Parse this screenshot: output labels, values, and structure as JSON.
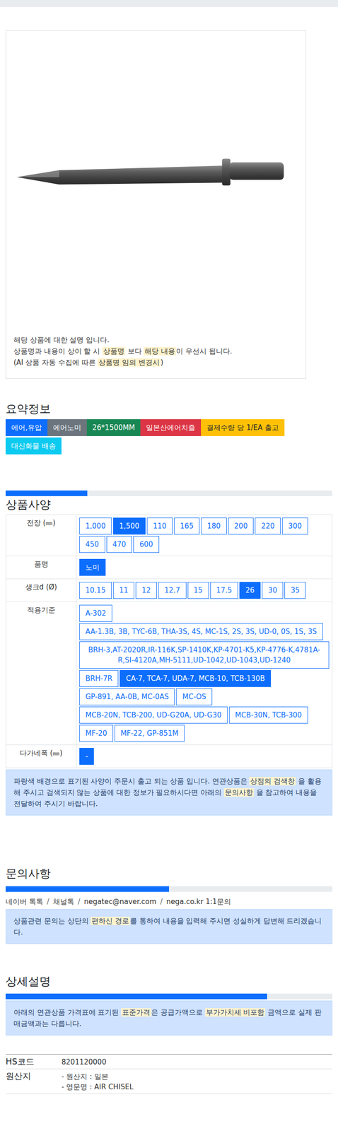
{
  "notice": {
    "lines": [
      [
        {
          "text": "해당 상품에 대한 설명 입니다.",
          "highlight": false
        }
      ],
      [
        {
          "text": "상품명과 내용이 상이 할 시 ",
          "highlight": false
        },
        {
          "text": "상품명",
          "highlight": true
        },
        {
          "text": " 보다 ",
          "highlight": false
        },
        {
          "text": "해당 내용",
          "highlight": true
        },
        {
          "text": "이 우선시 됩니다.",
          "highlight": false
        }
      ],
      [
        {
          "text": "(AI 상품 자동 수집에 따른 ",
          "highlight": false
        },
        {
          "text": "상품명 임의 변경시",
          "highlight": true
        },
        {
          "text": ")",
          "highlight": false
        }
      ]
    ]
  },
  "summary": {
    "title": "요약정보",
    "tags": [
      {
        "label": "에어,유압",
        "color": "#0d6efd"
      },
      {
        "label": "에어노미",
        "color": "#6c757d"
      },
      {
        "label": "26*1500MM",
        "color": "#198754"
      },
      {
        "label": "일본산에어치즐",
        "color": "#dc3545"
      },
      {
        "label": "결제수량 당 1/EA 출고",
        "color": "#ffc107"
      },
      {
        "label": "대신화물 배송",
        "color": "#0dcaf0"
      }
    ]
  },
  "specs": {
    "title": "상품사양",
    "level": 0.25,
    "rows": [
      {
        "label": "전장 (㎜)",
        "options": [
          {
            "label": "1,000",
            "selected": false
          },
          {
            "label": "1,500",
            "selected": true
          },
          {
            "label": "110",
            "selected": false
          },
          {
            "label": "165",
            "selected": false
          },
          {
            "label": "180",
            "selected": false
          },
          {
            "label": "200",
            "selected": false
          },
          {
            "label": "220",
            "selected": false
          },
          {
            "label": "300",
            "selected": false
          },
          {
            "label": "450",
            "selected": false
          },
          {
            "label": "470",
            "selected": false
          },
          {
            "label": "600",
            "selected": false
          }
        ]
      },
      {
        "label": "품명",
        "options": [
          {
            "label": "노미",
            "selected": true
          }
        ]
      },
      {
        "label": "생크d (Ø)",
        "options": [
          {
            "label": "10.15",
            "selected": false
          },
          {
            "label": "11",
            "selected": false
          },
          {
            "label": "12",
            "selected": false
          },
          {
            "label": "12.7",
            "selected": false
          },
          {
            "label": "15",
            "selected": false
          },
          {
            "label": "17.5",
            "selected": false
          },
          {
            "label": "26",
            "selected": true
          },
          {
            "label": "30",
            "selected": false
          },
          {
            "label": "35",
            "selected": false
          }
        ]
      },
      {
        "label": "적용기준",
        "options": [
          {
            "label": "A-302",
            "selected": false
          },
          {
            "label": "AA-1.3B, 3B, TYC-6B, THA-3S, 4S, MC-1S, 2S, 3S, UD-0, 0S, 1S, 3S",
            "selected": false
          },
          {
            "label": "BRH-3,AT-2020R,IR-116K,SP-1410K,KP-4701-K5,KP-4776-K,4781A-R,SI-4120A,MH-5111,UD-1042,UD-1043,UD-1240",
            "selected": false
          },
          {
            "label": "BRH-7R",
            "selected": false
          },
          {
            "label": "CA-7, TCA-7, UDA-7, MCB-10, TCB-130B",
            "selected": true
          },
          {
            "label": "GP-891, AA-0B, MC-0AS",
            "selected": false
          },
          {
            "label": "MC-OS",
            "selected": false
          },
          {
            "label": "MCB-20N, TCB-200, UD-G20A, UD-G30",
            "selected": false
          },
          {
            "label": "MCB-30N, TCB-300",
            "selected": false
          },
          {
            "label": "MF-20",
            "selected": false
          },
          {
            "label": "MF-22, GP-851M",
            "selected": false
          }
        ]
      },
      {
        "label": "다가네폭 (㎜)",
        "options": [
          {
            "label": "-",
            "selected": true
          }
        ]
      }
    ],
    "info": [
      {
        "text": "파랑색 배경으로 표기된 사양이 주문시 출고 되는 상품 입니다. 연관상품은 ",
        "highlight": false
      },
      {
        "text": "상점의 검색창",
        "highlight": true
      },
      {
        "text": " 을 활용해 주시고 검색되지 않는 상품에 대한 정보가 필요하시다면 아래의 ",
        "highlight": false
      },
      {
        "text": "문의사항",
        "highlight": true
      },
      {
        "text": " 을 참고하여 내용을 전달하여 주시기 바랍니다.",
        "highlight": false
      }
    ]
  },
  "inquiry": {
    "title": "문의사항",
    "level": 0.5,
    "separator": "/",
    "links": [
      "네이버 톡톡",
      "채널톡",
      "negatec@naver.com",
      "nega.co.kr 1:1문의"
    ],
    "info": [
      {
        "text": "상품관련 문의는 상단의 ",
        "highlight": false
      },
      {
        "text": "편하신 경로",
        "highlight": true
      },
      {
        "text": "를 통하여 내용을 입력해 주시면 성실하게 답변해 드리겠습니다.",
        "highlight": false
      }
    ]
  },
  "detail": {
    "title": "상세설명",
    "level": 0.8,
    "info": [
      {
        "text": "아래의 연관상품 가격표에 표기된 ",
        "highlight": false
      },
      {
        "text": "표준가격",
        "highlight": true
      },
      {
        "text": "은 공급가액으로 ",
        "highlight": false
      },
      {
        "text": "부가가치세 비포함",
        "highlight": true
      },
      {
        "text": " 금액으로 실제 판매금액과는 다릅니다.",
        "highlight": false
      }
    ],
    "rows": [
      {
        "label": "HS코드",
        "values": [
          "8201120000"
        ]
      },
      {
        "label": "원산지",
        "values": [
          "- 원산지 : 일본",
          "- 영문명 : AIR CHISEL"
        ]
      }
    ]
  }
}
